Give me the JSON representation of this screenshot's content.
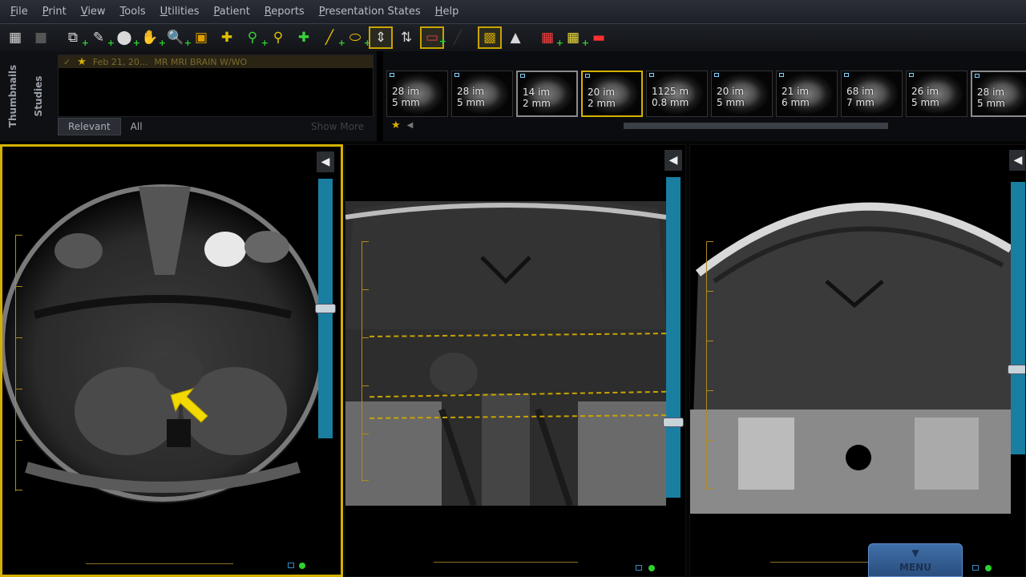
{
  "menubar": {
    "items": [
      {
        "label": "File"
      },
      {
        "label": "Print"
      },
      {
        "label": "View"
      },
      {
        "label": "Tools"
      },
      {
        "label": "Utilities"
      },
      {
        "label": "Patient"
      },
      {
        "label": "Reports"
      },
      {
        "label": "Presentation States"
      },
      {
        "label": "Help"
      }
    ]
  },
  "toolbar": {
    "icons": [
      "zoom-fit-icon",
      "blank-icon",
      "layers-icon",
      "measure-icon",
      "ellipse-roi-icon",
      "pan-hand-icon",
      "magnify-icon",
      "crop-icon",
      "crosshair-icon",
      "pin-icon",
      "probe-icon",
      "add-annotation-icon",
      "line-tool-icon",
      "oval-tool-icon",
      "stack-sync-icon",
      "scroll-sync-icon",
      "flip-icon",
      "reset-icon",
      "invert-icon",
      "cine-icon",
      "layout-grid-icon",
      "layout-tile-icon",
      "window-level-icon"
    ]
  },
  "studies_panel": {
    "tab_thumbnails": "Thumbnails",
    "tab_studies": "Studies",
    "study_row": {
      "date": "Feb 21, 20...",
      "description": "MR  MRI BRAIN W/WO"
    },
    "filters": {
      "relevant": "Relevant",
      "all": "All",
      "show_more": "Show More"
    }
  },
  "thumbnails": [
    {
      "line1": "28 im",
      "line2": "5 mm",
      "state": "normal"
    },
    {
      "line1": "28 im",
      "line2": "5 mm",
      "state": "normal"
    },
    {
      "line1": "14 im",
      "line2": "2 mm",
      "state": "gray"
    },
    {
      "line1": "20 im",
      "line2": "2 mm",
      "state": "selected"
    },
    {
      "line1": "1125 m",
      "line2": "0.8 mm",
      "state": "normal"
    },
    {
      "line1": "20 im",
      "line2": "5 mm",
      "state": "normal"
    },
    {
      "line1": "21 im",
      "line2": "6 mm",
      "state": "normal"
    },
    {
      "line1": "68 im",
      "line2": "7 mm",
      "state": "normal"
    },
    {
      "line1": "26 im",
      "line2": "5 mm",
      "state": "normal"
    },
    {
      "line1": "28 im",
      "line2": "5 mm",
      "state": "gray"
    }
  ],
  "viewports": {
    "left": {
      "plane": "axial",
      "annotation": "yellow-arrow"
    },
    "middle": {
      "plane": "coronal"
    },
    "right": {
      "plane": "coronal"
    }
  },
  "menu_tab": {
    "label": "MENU"
  },
  "colors": {
    "accent": "#d4b100",
    "scroll": "#1a7ea1",
    "green": "#2fd02f"
  }
}
